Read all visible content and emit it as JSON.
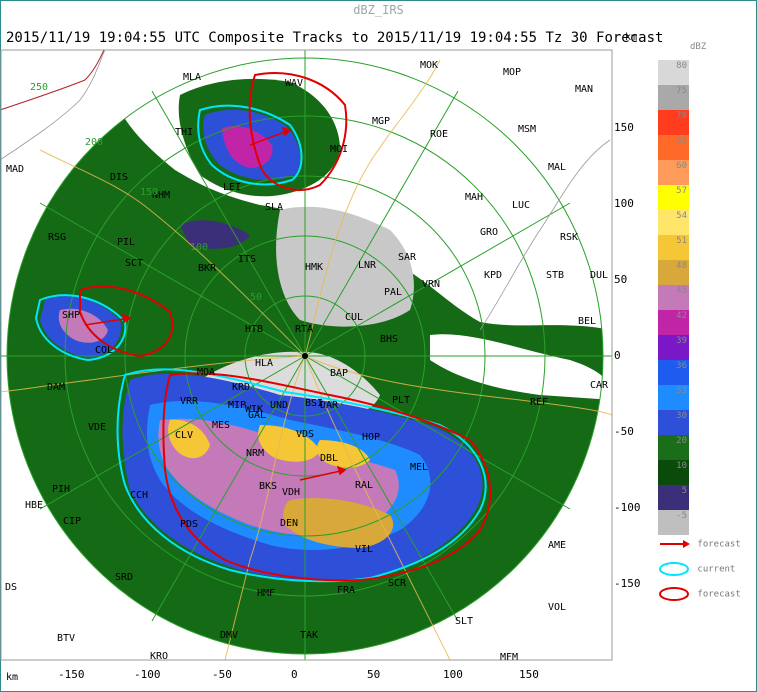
{
  "window": {
    "title": "dBZ_IRS"
  },
  "header": {
    "subtitle": "2015/11/19 19:04:55 UTC Composite Tracks to 2015/11/19 19:04:55 Tz 30 Forecast"
  },
  "axes": {
    "unit": "km",
    "x_ticks": [
      "-150",
      "-100",
      "-50",
      "0",
      "50",
      "100",
      "150"
    ],
    "y_ticks": [
      "150",
      "100",
      "50",
      "0",
      "-50",
      "-100",
      "-150"
    ]
  },
  "range_rings": [
    "250",
    "200",
    "150",
    "100",
    "50"
  ],
  "legend": {
    "title": "dBZ",
    "levels": [
      {
        "label": "80",
        "color": "#d8d8d8"
      },
      {
        "label": "75",
        "color": "#a9a9a9"
      },
      {
        "label": "70",
        "color": "#ff3c1e"
      },
      {
        "label": "65",
        "color": "#ff6a28"
      },
      {
        "label": "60",
        "color": "#ff9a5a"
      },
      {
        "label": "57",
        "color": "#ffff00"
      },
      {
        "label": "54",
        "color": "#ffe66a"
      },
      {
        "label": "51",
        "color": "#f5c635"
      },
      {
        "label": "48",
        "color": "#d8a93a"
      },
      {
        "label": "45",
        "color": "#c47ab8"
      },
      {
        "label": "42",
        "color": "#c025a8"
      },
      {
        "label": "39",
        "color": "#7a18c8"
      },
      {
        "label": "36",
        "color": "#1e5cf0"
      },
      {
        "label": "33",
        "color": "#1e8cff"
      },
      {
        "label": "30",
        "color": "#2e4fd8"
      },
      {
        "label": "20",
        "color": "#1a6e1a"
      },
      {
        "label": "10",
        "color": "#0a4a0a"
      },
      {
        "label": "5",
        "color": "#3b2f7a"
      },
      {
        "label": "-5",
        "color": "#bfbfbf"
      }
    ],
    "keys": [
      {
        "label": "forecast",
        "kind": "arrow",
        "color": "#e00000"
      },
      {
        "label": "current",
        "kind": "ellipse",
        "color": "#00e5ff"
      },
      {
        "label": "forecast",
        "kind": "ellipse",
        "color": "#e00000"
      }
    ]
  },
  "stations": [
    "MLA",
    "WAV",
    "MOK",
    "MOP",
    "MAN",
    "THI",
    "MGP",
    "ROE",
    "MSM",
    "MAD",
    "DIS",
    "MOI",
    "NHM",
    "LEI",
    "MAL",
    "MAH",
    "LUC",
    "PIL",
    "SLA",
    "RSK",
    "RSG",
    "SCT",
    "ITS",
    "GRO",
    "SAR",
    "BKR",
    "HMK",
    "LNR",
    "KPD",
    "STB",
    "DUL",
    "PAL",
    "VRN",
    "CUL",
    "BEL",
    "SHP",
    "BHS",
    "COL",
    "RTA",
    "HTB",
    "HLA",
    "BAP",
    "CAR",
    "DAM",
    "MOA",
    "KRD",
    "UND",
    "MIP",
    "REF",
    "VRR",
    "MES",
    "CLV",
    "GAL",
    "VDS",
    "NRM",
    "HOP",
    "DBL",
    "RAL",
    "MEL",
    "BKS",
    "PIH",
    "CCH",
    "DEN",
    "PDS",
    "HBE",
    "CIP",
    "VIL",
    "AME",
    "DS",
    "SRD",
    "FRA",
    "VOL",
    "BTV",
    "HMF",
    "TAK",
    "SCR",
    "MFM",
    "KRO",
    "DMV",
    "SLT",
    "WIK",
    "VDE",
    "BSI",
    "VDH",
    "DAR",
    "PLT"
  ]
}
